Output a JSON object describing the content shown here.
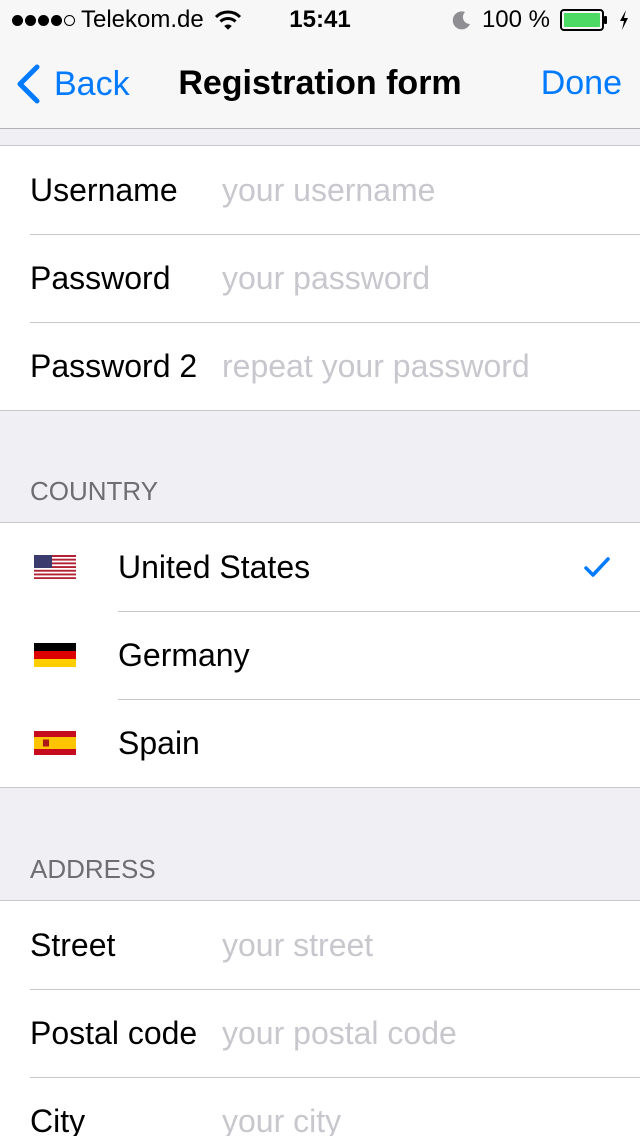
{
  "status": {
    "carrier": "Telekom.de",
    "time": "15:41",
    "battery": "100 %",
    "signal_bars": 4
  },
  "nav": {
    "back_label": "Back",
    "title": "Registration form",
    "done_label": "Done"
  },
  "account_section": {
    "fields": [
      {
        "label": "Username",
        "placeholder": "your username",
        "value": ""
      },
      {
        "label": "Password",
        "placeholder": "your password",
        "value": ""
      },
      {
        "label": "Password 2",
        "placeholder": "repeat your password",
        "value": ""
      }
    ]
  },
  "country_section": {
    "header": "COUNTRY",
    "options": [
      {
        "name": "United States",
        "flag": "us-flag-icon",
        "selected": true
      },
      {
        "name": "Germany",
        "flag": "germany-flag-icon",
        "selected": false
      },
      {
        "name": "Spain",
        "flag": "spain-flag-icon",
        "selected": false
      }
    ]
  },
  "address_section": {
    "header": "ADDRESS",
    "fields": [
      {
        "label": "Street",
        "placeholder": "your street",
        "value": ""
      },
      {
        "label": "Postal code",
        "placeholder": "your postal code",
        "value": ""
      },
      {
        "label": "City",
        "placeholder": "your city",
        "value": ""
      }
    ]
  },
  "colors": {
    "accent": "#007aff",
    "group_background": "#efeff4",
    "separator": "#c8c7cc",
    "placeholder": "#c7c7cd",
    "section_header": "#6d6d72",
    "battery_fill": "#4cd964"
  }
}
